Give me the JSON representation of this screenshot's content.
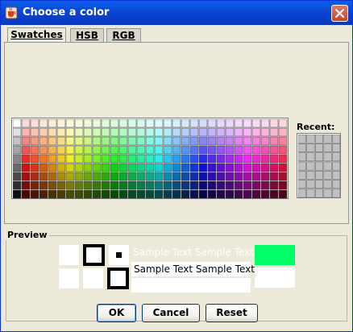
{
  "window": {
    "title": "Choose a color",
    "icon": "java-cup-icon",
    "close_icon": "close-icon"
  },
  "tabs": [
    {
      "label": "Swatches",
      "mnemonic": "S",
      "active": true
    },
    {
      "label": "HSB",
      "mnemonic": "H",
      "active": false
    },
    {
      "label": "RGB",
      "mnemonic": "G",
      "active": false
    }
  ],
  "swatches": {
    "columns": 31,
    "rows": 9
  },
  "recent": {
    "label": "Recent:",
    "columns": 5,
    "rows": 7,
    "fill": "#c0c0c0"
  },
  "preview": {
    "legend": "Preview",
    "sample_text": "Sample Text  Sample Text",
    "selected_color": "#00ff66"
  },
  "buttons": {
    "ok": "OK",
    "cancel": "Cancel",
    "reset": "Reset"
  },
  "colors": {
    "title_bar": "#0a4fd8",
    "dialog_bg": "#ece9d8"
  }
}
